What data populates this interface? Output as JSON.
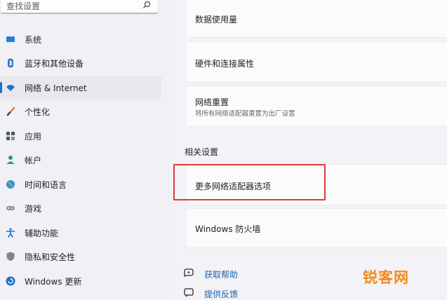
{
  "search": {
    "placeholder": "查找设置"
  },
  "sidebar": {
    "items": [
      {
        "label": "系统",
        "icon": "monitor-icon"
      },
      {
        "label": "蓝牙和其他设备",
        "icon": "bluetooth-icon"
      },
      {
        "label": "网络 & Internet",
        "icon": "wifi-icon",
        "active": true
      },
      {
        "label": "个性化",
        "icon": "brush-icon"
      },
      {
        "label": "应用",
        "icon": "apps-icon"
      },
      {
        "label": "帐户",
        "icon": "person-icon"
      },
      {
        "label": "时间和语言",
        "icon": "globe-clock-icon"
      },
      {
        "label": "游戏",
        "icon": "gamepad-icon"
      },
      {
        "label": "辅助功能",
        "icon": "accessibility-icon"
      },
      {
        "label": "隐私和安全性",
        "icon": "shield-icon"
      },
      {
        "label": "Windows 更新",
        "icon": "update-icon"
      }
    ]
  },
  "main": {
    "cards_top": [
      {
        "title": "数据使用量"
      },
      {
        "title": "硬件和连接属性"
      },
      {
        "title": "网络重置",
        "subtitle": "将所有网络适配器重置为出厂设置"
      }
    ],
    "related_heading": "相关设置",
    "related": [
      {
        "title": "更多网络适配器选项"
      },
      {
        "title": "Windows 防火墙"
      }
    ],
    "links": [
      {
        "label": "获取帮助",
        "icon": "help-icon"
      },
      {
        "label": "提供反馈",
        "icon": "feedback-icon"
      }
    ]
  },
  "watermark": "锐客网",
  "colors": {
    "accent": "#1a73c8",
    "highlight_border": "#dd3b3b",
    "watermark": "#f08c1b",
    "link": "#1b63b0"
  }
}
